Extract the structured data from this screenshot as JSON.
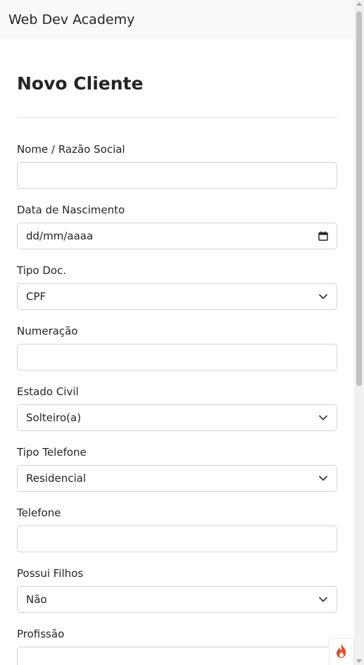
{
  "navbar": {
    "brand": "Web Dev Academy"
  },
  "page": {
    "title": "Novo Cliente"
  },
  "form": {
    "nome": {
      "label": "Nome / Razão Social",
      "value": ""
    },
    "nascimento": {
      "label": "Data de Nascimento",
      "placeholder": "dd/mm/aaaa"
    },
    "tipo_doc": {
      "label": "Tipo Doc.",
      "value": "CPF"
    },
    "numeracao": {
      "label": "Numeração",
      "value": ""
    },
    "estado_civil": {
      "label": "Estado Civil",
      "value": "Solteiro(a)"
    },
    "tipo_telefone": {
      "label": "Tipo Telefone",
      "value": "Residencial"
    },
    "telefone": {
      "label": "Telefone",
      "value": ""
    },
    "possui_filhos": {
      "label": "Possui Filhos",
      "value": "Não"
    },
    "profissao": {
      "label": "Profissão"
    }
  },
  "icons": {
    "calendar": "calendar-icon",
    "chevron": "chevron-down-icon",
    "fab": "flame-icon"
  },
  "colors": {
    "navbar_bg": "#f8f9fa",
    "border": "#ced4da",
    "text": "#212529",
    "flame": "#e34c26"
  }
}
